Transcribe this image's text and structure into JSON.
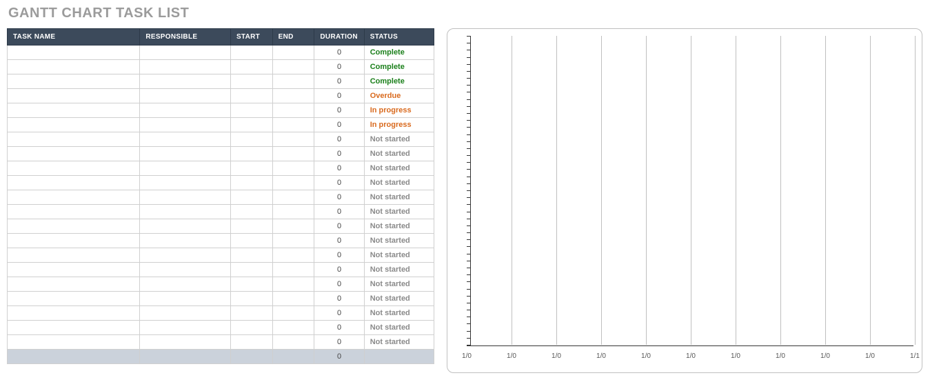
{
  "title": "GANTT CHART TASK LIST",
  "table": {
    "headers": {
      "task": "TASK NAME",
      "responsible": "RESPONSIBLE",
      "start": "START",
      "end": "END",
      "duration": "DURATION",
      "status": "STATUS"
    },
    "rows": [
      {
        "task": "",
        "responsible": "",
        "start": "",
        "end": "",
        "duration": "0",
        "status": "Complete",
        "status_kind": "complete"
      },
      {
        "task": "",
        "responsible": "",
        "start": "",
        "end": "",
        "duration": "0",
        "status": "Complete",
        "status_kind": "complete"
      },
      {
        "task": "",
        "responsible": "",
        "start": "",
        "end": "",
        "duration": "0",
        "status": "Complete",
        "status_kind": "complete"
      },
      {
        "task": "",
        "responsible": "",
        "start": "",
        "end": "",
        "duration": "0",
        "status": "Overdue",
        "status_kind": "overdue"
      },
      {
        "task": "",
        "responsible": "",
        "start": "",
        "end": "",
        "duration": "0",
        "status": "In progress",
        "status_kind": "in-progress"
      },
      {
        "task": "",
        "responsible": "",
        "start": "",
        "end": "",
        "duration": "0",
        "status": "In progress",
        "status_kind": "in-progress"
      },
      {
        "task": "",
        "responsible": "",
        "start": "",
        "end": "",
        "duration": "0",
        "status": "Not started",
        "status_kind": "not-started"
      },
      {
        "task": "",
        "responsible": "",
        "start": "",
        "end": "",
        "duration": "0",
        "status": "Not started",
        "status_kind": "not-started"
      },
      {
        "task": "",
        "responsible": "",
        "start": "",
        "end": "",
        "duration": "0",
        "status": "Not started",
        "status_kind": "not-started"
      },
      {
        "task": "",
        "responsible": "",
        "start": "",
        "end": "",
        "duration": "0",
        "status": "Not started",
        "status_kind": "not-started"
      },
      {
        "task": "",
        "responsible": "",
        "start": "",
        "end": "",
        "duration": "0",
        "status": "Not started",
        "status_kind": "not-started"
      },
      {
        "task": "",
        "responsible": "",
        "start": "",
        "end": "",
        "duration": "0",
        "status": "Not started",
        "status_kind": "not-started"
      },
      {
        "task": "",
        "responsible": "",
        "start": "",
        "end": "",
        "duration": "0",
        "status": "Not started",
        "status_kind": "not-started"
      },
      {
        "task": "",
        "responsible": "",
        "start": "",
        "end": "",
        "duration": "0",
        "status": "Not started",
        "status_kind": "not-started"
      },
      {
        "task": "",
        "responsible": "",
        "start": "",
        "end": "",
        "duration": "0",
        "status": "Not started",
        "status_kind": "not-started"
      },
      {
        "task": "",
        "responsible": "",
        "start": "",
        "end": "",
        "duration": "0",
        "status": "Not started",
        "status_kind": "not-started"
      },
      {
        "task": "",
        "responsible": "",
        "start": "",
        "end": "",
        "duration": "0",
        "status": "Not started",
        "status_kind": "not-started"
      },
      {
        "task": "",
        "responsible": "",
        "start": "",
        "end": "",
        "duration": "0",
        "status": "Not started",
        "status_kind": "not-started"
      },
      {
        "task": "",
        "responsible": "",
        "start": "",
        "end": "",
        "duration": "0",
        "status": "Not started",
        "status_kind": "not-started"
      },
      {
        "task": "",
        "responsible": "",
        "start": "",
        "end": "",
        "duration": "0",
        "status": "Not started",
        "status_kind": "not-started"
      },
      {
        "task": "",
        "responsible": "",
        "start": "",
        "end": "",
        "duration": "0",
        "status": "Not started",
        "status_kind": "not-started"
      }
    ],
    "total_row": {
      "task": "",
      "responsible": "",
      "start": "",
      "end": "",
      "duration": "0",
      "status": ""
    }
  },
  "chart_data": {
    "type": "bar",
    "title": "",
    "xlabel": "",
    "ylabel": "",
    "x_ticks": [
      "1/0",
      "1/0",
      "1/0",
      "1/0",
      "1/0",
      "1/0",
      "1/0",
      "1/0",
      "1/0",
      "1/0",
      "1/1"
    ],
    "y_ticks_count": 44,
    "series": [],
    "notes": "Empty Gantt timeline — no bars plotted; vertical gridlines at each x tick."
  }
}
